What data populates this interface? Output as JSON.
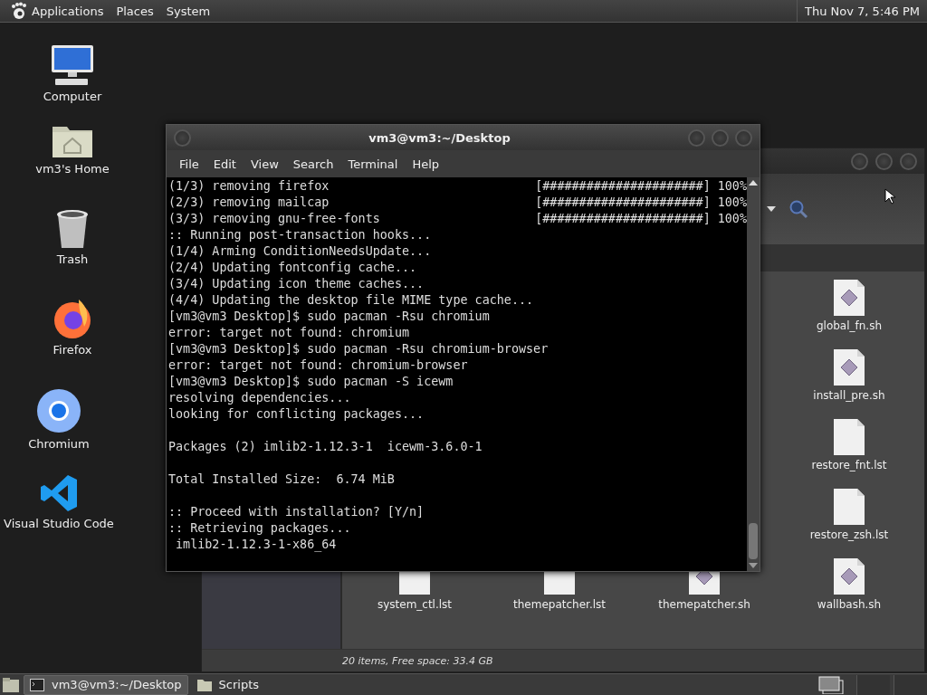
{
  "top_panel": {
    "menus": [
      "Applications",
      "Places",
      "System"
    ],
    "clock": "Thu Nov 7, 5:46 PM"
  },
  "desktop_icons": [
    {
      "label": "Computer",
      "kind": "computer"
    },
    {
      "label": "vm3's Home",
      "kind": "home"
    },
    {
      "label": "Trash",
      "kind": "trash"
    },
    {
      "label": "Firefox",
      "kind": "firefox"
    },
    {
      "label": "Chromium",
      "kind": "chromium"
    },
    {
      "label": "Visual Studio Code",
      "kind": "vscode"
    }
  ],
  "file_manager": {
    "files": [
      {
        "name": "global_fn.sh",
        "kind": "script"
      },
      {
        "name": "install_pre.sh",
        "kind": "script"
      },
      {
        "name": "restore_fnt.lst",
        "kind": "text"
      },
      {
        "name": "restore_zsh.lst",
        "kind": "text"
      },
      {
        "name": "system_ctl.lst",
        "kind": "text"
      },
      {
        "name": "themepatcher.lst",
        "kind": "text"
      },
      {
        "name": "themepatcher.sh",
        "kind": "script"
      },
      {
        "name": "wallbash.sh",
        "kind": "script"
      }
    ],
    "status": "20 items, Free space: 33.4 GB"
  },
  "terminal": {
    "title": "vm3@vm3:~/Desktop",
    "menu": [
      "File",
      "Edit",
      "View",
      "Search",
      "Terminal",
      "Help"
    ],
    "lines": [
      {
        "kind": "text",
        "text": "(1/3) removing firefox",
        "progress": "[######################] 100%"
      },
      {
        "kind": "text",
        "text": "(2/3) removing mailcap",
        "progress": "[######################] 100%"
      },
      {
        "kind": "text",
        "text": "(3/3) removing gnu-free-fonts",
        "progress": "[######################] 100%"
      },
      {
        "kind": "text",
        "text": ":: Running post-transaction hooks..."
      },
      {
        "kind": "text",
        "text": "(1/4) Arming ConditionNeedsUpdate..."
      },
      {
        "kind": "text",
        "text": "(2/4) Updating fontconfig cache..."
      },
      {
        "kind": "text",
        "text": "(3/4) Updating icon theme caches..."
      },
      {
        "kind": "text",
        "text": "(4/4) Updating the desktop file MIME type cache..."
      },
      {
        "kind": "text",
        "text": "[vm3@vm3 Desktop]$ sudo pacman -Rsu chromium"
      },
      {
        "kind": "text",
        "text": "error: target not found: chromium"
      },
      {
        "kind": "text",
        "text": "[vm3@vm3 Desktop]$ sudo pacman -Rsu chromium-browser"
      },
      {
        "kind": "text",
        "text": "error: target not found: chromium-browser"
      },
      {
        "kind": "text",
        "text": "[vm3@vm3 Desktop]$ sudo pacman -S icewm"
      },
      {
        "kind": "text",
        "text": "resolving dependencies..."
      },
      {
        "kind": "text",
        "text": "looking for conflicting packages..."
      },
      {
        "kind": "blank"
      },
      {
        "kind": "text",
        "text": "Packages (2) imlib2-1.12.3-1  icewm-3.6.0-1"
      },
      {
        "kind": "blank"
      },
      {
        "kind": "text",
        "text": "Total Installed Size:  6.74 MiB"
      },
      {
        "kind": "blank"
      },
      {
        "kind": "text",
        "text": ":: Proceed with installation? [Y/n]"
      },
      {
        "kind": "text",
        "text": ":: Retrieving packages..."
      },
      {
        "kind": "text",
        "text": " imlib2-1.12.3-1-x86_64"
      }
    ]
  },
  "taskbar": {
    "tasks": [
      {
        "label": "vm3@vm3:~/Desktop",
        "kind": "terminal",
        "selected": true
      },
      {
        "label": "Scripts",
        "kind": "folder",
        "selected": false
      }
    ]
  }
}
